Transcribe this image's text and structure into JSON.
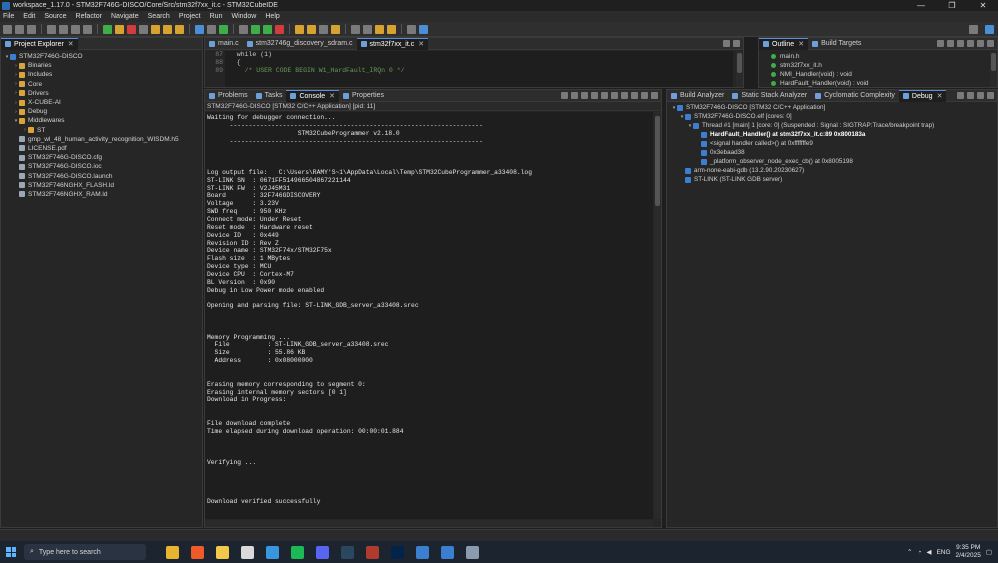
{
  "window": {
    "title": "workspace_1.17.0 - STM32F746G-DISCO/Core/Src/stm32f7xx_it.c - STM32CubeIDE",
    "controls": [
      "—",
      "❐",
      "✕"
    ]
  },
  "menu": [
    "File",
    "Edit",
    "Source",
    "Refactor",
    "Navigate",
    "Search",
    "Project",
    "Run",
    "Window",
    "Help"
  ],
  "project_explorer": {
    "tab_label": "Project Explorer",
    "items": [
      {
        "label": "STM32F746G-DISCO",
        "type": "proj",
        "indent": 0,
        "twisty": "▾"
      },
      {
        "label": "Binaries",
        "type": "folder",
        "indent": 1,
        "twisty": "›"
      },
      {
        "label": "Includes",
        "type": "folder",
        "indent": 1,
        "twisty": "›"
      },
      {
        "label": "Core",
        "type": "folder",
        "indent": 1,
        "twisty": "›"
      },
      {
        "label": "Drivers",
        "type": "folder",
        "indent": 1,
        "twisty": "›"
      },
      {
        "label": "X-CUBE-AI",
        "type": "folder",
        "indent": 1,
        "twisty": "›"
      },
      {
        "label": "Debug",
        "type": "folder",
        "indent": 1,
        "twisty": "›"
      },
      {
        "label": "Middlewares",
        "type": "folder",
        "indent": 1,
        "twisty": "▾"
      },
      {
        "label": "ST",
        "type": "folder",
        "indent": 2,
        "twisty": "›"
      },
      {
        "label": "gmp_wl_48_human_activity_recognition_WISDM.h5",
        "type": "file",
        "indent": 1,
        "twisty": ""
      },
      {
        "label": "LICENSE.pdf",
        "type": "file",
        "indent": 1,
        "twisty": ""
      },
      {
        "label": "STM32F746G-DISCO.cfg",
        "type": "file",
        "indent": 1,
        "twisty": ""
      },
      {
        "label": "STM32F746G-DISCO.ioc",
        "type": "file",
        "indent": 1,
        "twisty": ""
      },
      {
        "label": "STM32F746G-DISCO.launch",
        "type": "file",
        "indent": 1,
        "twisty": ""
      },
      {
        "label": "STM32F746NGHX_FLASH.ld",
        "type": "file",
        "indent": 1,
        "twisty": ""
      },
      {
        "label": "STM32F746NGHX_RAM.ld",
        "type": "file",
        "indent": 1,
        "twisty": ""
      }
    ]
  },
  "editor": {
    "tabs": [
      {
        "label": "main.c",
        "active": false
      },
      {
        "label": "stm32746g_discovery_sdram.c",
        "active": false
      },
      {
        "label": "stm32f7xx_it.c",
        "active": true
      }
    ],
    "lines": [
      {
        "num": "87",
        "text": "  while (1)"
      },
      {
        "num": "88",
        "text": "  {"
      },
      {
        "num": "89",
        "text": "    /* USER CODE BEGIN W1_HardFault_IRQn 0 */"
      }
    ]
  },
  "outline": {
    "tabs": [
      {
        "label": "Outline",
        "active": true
      },
      {
        "label": "Build Targets",
        "active": false
      }
    ],
    "items": [
      "main.h",
      "stm32f7xx_it.h",
      "NMI_Handler(void) : void",
      "HardFault_Handler(void) : void"
    ]
  },
  "console": {
    "tabs": [
      {
        "label": "Problems",
        "active": false
      },
      {
        "label": "Tasks",
        "active": false
      },
      {
        "label": "Console",
        "active": true
      },
      {
        "label": "Properties",
        "active": false
      }
    ],
    "subtitle": "STM32F746G-DISCO [STM32 C/C++ Application] [pid: 11]",
    "lines": [
      "Waiting for debugger connection...",
      "      -------------------------------------------------------------------",
      "                        STM32CubeProgrammer v2.18.0",
      "      -------------------------------------------------------------------",
      "",
      "",
      "",
      "Log output file:   C:\\Users\\RAMY'S~1\\AppData\\Local\\Temp\\STM32CubeProgrammer_a33408.log",
      "ST-LINK SN  : 0671FF514966504867221144",
      "ST-LINK FW  : V2J45M31",
      "Board       : 32F746GDISCOVERY",
      "Voltage     : 3.23V",
      "SWD freq    : 950 KHz",
      "Connect mode: Under Reset",
      "Reset mode  : Hardware reset",
      "Device ID   : 0x449",
      "Revision ID : Rev Z",
      "Device name : STM32F74x/STM32F75x",
      "Flash size  : 1 MBytes",
      "Device type : MCU",
      "Device CPU  : Cortex-M7",
      "BL Version  : 0x90",
      "Debug in Low Power mode enabled",
      "",
      "Opening and parsing file: ST-LINK_GDB_server_a33408.srec",
      "",
      "",
      "",
      "Memory Programming ...",
      "  File          : ST-LINK_GDB_server_a33408.srec",
      "  Size          : 55.86 KB",
      "  Address       : 0x08000000",
      "",
      "",
      "Erasing memory corresponding to segment 0:",
      "Erasing internal memory sectors [0 1]",
      "Download in Progress:",
      "",
      "",
      "File download complete",
      "Time elapsed during download operation: 00:00:01.884",
      "",
      "",
      "",
      "Verifying ...",
      "",
      "",
      "",
      "",
      "Download verified successfully"
    ]
  },
  "debug": {
    "tabs": [
      {
        "label": "Build Analyzer",
        "active": false
      },
      {
        "label": "Static Stack Analyzer",
        "active": false
      },
      {
        "label": "Cyclomatic Complexity",
        "active": false
      },
      {
        "label": "Debug",
        "active": true
      }
    ],
    "items": [
      {
        "label": "STM32F746G-DISCO [STM32 C/C++ Application]",
        "indent": 0,
        "twisty": "▾",
        "bold": false
      },
      {
        "label": "STM32F746G-DISCO.elf [cores: 0]",
        "indent": 1,
        "twisty": "▾",
        "bold": false
      },
      {
        "label": "Thread #1 [main] 1 [core: 0] (Suspended : Signal : SIGTRAP:Trace/breakpoint trap)",
        "indent": 2,
        "twisty": "▾",
        "bold": false
      },
      {
        "label": "HardFault_Handler() at stm32f7xx_it.c:89 0x800183a",
        "indent": 3,
        "twisty": "",
        "bold": true
      },
      {
        "label": "<signal handler called>() at 0xfffffffe9",
        "indent": 3,
        "twisty": "",
        "bold": false
      },
      {
        "label": "0x3ebaad38",
        "indent": 3,
        "twisty": "",
        "bold": false
      },
      {
        "label": "_platform_observer_node_exec_cb() at 0x8005198",
        "indent": 3,
        "twisty": "",
        "bold": false
      },
      {
        "label": "arm-none-eabi-gdb (13.2.90.20230627)",
        "indent": 1,
        "twisty": "",
        "bold": false
      },
      {
        "label": "ST-LINK (ST-LINK GDB server)",
        "indent": 1,
        "twisty": "",
        "bold": false
      }
    ]
  },
  "taskbar": {
    "search_placeholder": "Type here to search",
    "apps": [
      {
        "name": "chrome-icon",
        "color": "#e8b32f"
      },
      {
        "name": "brave-icon",
        "color": "#f05a28"
      },
      {
        "name": "file-explorer-icon",
        "color": "#f2c84b"
      },
      {
        "name": "chatgpt-icon",
        "color": "#d9d9d9"
      },
      {
        "name": "vscode-icon",
        "color": "#3a96dd"
      },
      {
        "name": "spotify-icon",
        "color": "#1db954"
      },
      {
        "name": "discord-icon",
        "color": "#5865f2"
      },
      {
        "name": "steam-icon",
        "color": "#2a475e"
      },
      {
        "name": "winrar-icon",
        "color": "#b03a2e"
      },
      {
        "name": "stm32-programmer-icon",
        "color": "#03234b"
      },
      {
        "name": "mx-icon",
        "color": "#3c7fd0"
      },
      {
        "name": "ide-icon",
        "color": "#3c7fd0"
      },
      {
        "name": "desktop-app-icon",
        "color": "#8a9bb0"
      }
    ],
    "tray_lang": "ENG",
    "time": "9:35 PM",
    "date": "2/4/2025"
  }
}
